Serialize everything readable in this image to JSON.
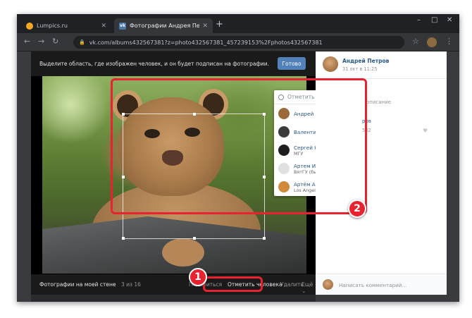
{
  "browser": {
    "tabs": [
      {
        "title": "Lumpics.ru",
        "active": false
      },
      {
        "title": "Фотографии Андрея Петрова -",
        "active": true
      }
    ],
    "url": "vk.com/albums432567381?z=photo432567381_457239153%2Fphotos432567381",
    "window_controls": [
      "–",
      "□",
      "✕"
    ]
  },
  "viewer": {
    "instruction": "Выделите область, где изображен человек, и он будет подписан на фотографии.",
    "done_label": "Готово",
    "album_name": "Фотографии на моей стене",
    "counter": "3 из 16",
    "actions": {
      "share": "Поделиться",
      "tag": "Отметить человека",
      "delete": "Удалить",
      "more": "Ещё ⌄"
    }
  },
  "tag_popup": {
    "search_placeholder": "Отметить человека...",
    "people": [
      {
        "name": "Андрей Петров (Вы)",
        "sub": "",
        "color": "#9a6a3a"
      },
      {
        "name": "Валентина Лазарева",
        "sub": "",
        "color": "#3a3a3a"
      },
      {
        "name": "Сергей Навальный",
        "sub": "МГУ",
        "color": "#1d1d1d"
      },
      {
        "name": "Артем Иванов",
        "sub": "ВятГУ (бывш. ВятГТУ, КирП...",
        "color": "#e0e0e0"
      },
      {
        "name": "Артём Антонычев",
        "sub": "Los Angeles Music Academy",
        "color": "#d08a3a"
      }
    ]
  },
  "side": {
    "author": "Андрей Петров",
    "date": "31 окт в 11:25",
    "description_label": "описание",
    "link_text": "ров",
    "position_text": "532",
    "comment_placeholder": "Написать комментарий..."
  },
  "annotations": {
    "badge1": "1",
    "badge2": "2",
    "accent": "#e8232f"
  },
  "colors": {
    "vk_blue": "#5181b8",
    "link_blue": "#2a5885"
  }
}
